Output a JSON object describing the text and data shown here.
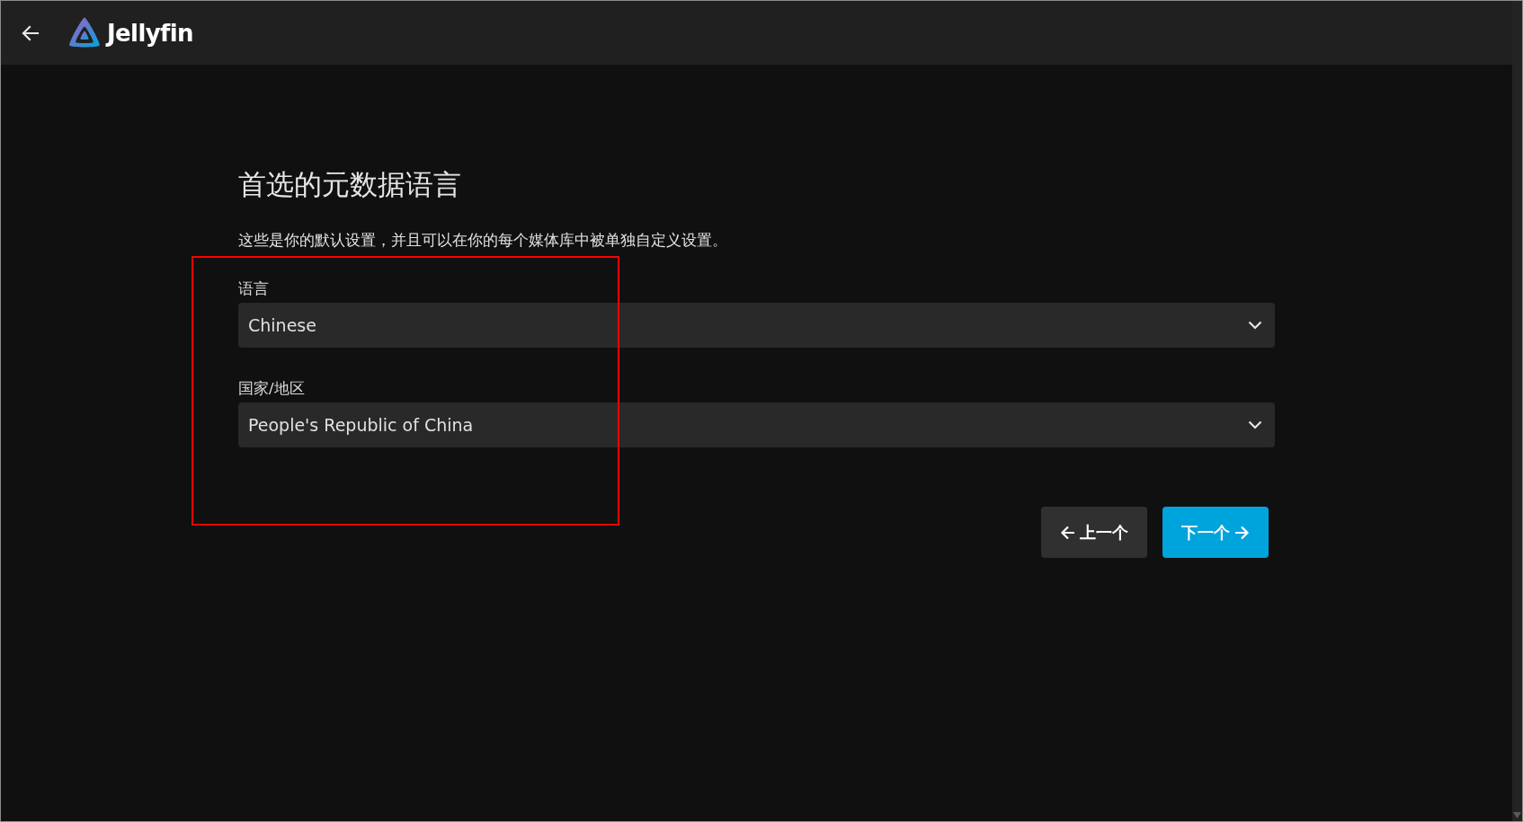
{
  "header": {
    "brand": "Jellyfin"
  },
  "page": {
    "title": "首选的元数据语言",
    "description": "这些是你的默认设置，并且可以在你的每个媒体库中被单独自定义设置。",
    "fields": [
      {
        "label": "语言",
        "value": "Chinese"
      },
      {
        "label": "国家/地区",
        "value": "People's Republic of China"
      }
    ],
    "buttons": [
      {
        "label": "上一个",
        "kind": "previous"
      },
      {
        "label": "下一个",
        "kind": "next"
      }
    ]
  }
}
